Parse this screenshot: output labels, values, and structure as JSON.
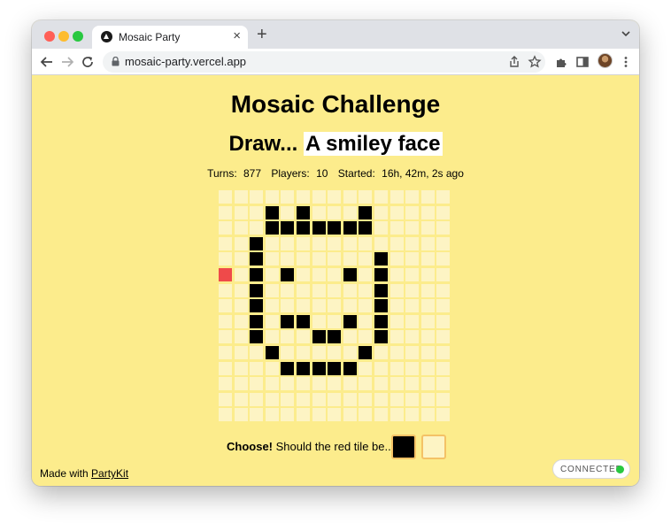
{
  "browser": {
    "tab_title": "Mosaic Party",
    "url": "mosaic-party.vercel.app",
    "icons": [
      "back-icon",
      "forward-icon",
      "reload-icon",
      "lock-icon",
      "share-icon",
      "bookmark-star-icon",
      "extensions-icon",
      "side-panel-icon",
      "menu-icon",
      "tab-close-icon",
      "new-tab-icon",
      "tab-search-icon"
    ],
    "traffic_light_colors": [
      "#ff5f57",
      "#febc2e",
      "#28c840"
    ]
  },
  "page": {
    "title": "Mosaic Challenge",
    "prompt_prefix": "Draw...",
    "prompt_subject": "A smiley face",
    "stats": {
      "turns_label": "Turns:",
      "turns": "877",
      "players_label": "Players:",
      "players": "10",
      "started_label": "Started:",
      "started": "16h, 42m, 2s ago"
    }
  },
  "mosaic": {
    "size": 15,
    "colors": {
      "empty": "#fdf4c4",
      "black": "#000000",
      "selected": "#ef4a4a"
    },
    "black_tiles": [
      [
        3,
        1
      ],
      [
        5,
        1
      ],
      [
        9,
        1
      ],
      [
        3,
        2
      ],
      [
        4,
        2
      ],
      [
        5,
        2
      ],
      [
        6,
        2
      ],
      [
        7,
        2
      ],
      [
        8,
        2
      ],
      [
        9,
        2
      ],
      [
        2,
        3
      ],
      [
        2,
        4
      ],
      [
        10,
        4
      ],
      [
        2,
        5
      ],
      [
        4,
        5
      ],
      [
        8,
        5
      ],
      [
        10,
        5
      ],
      [
        2,
        6
      ],
      [
        10,
        6
      ],
      [
        2,
        7
      ],
      [
        10,
        7
      ],
      [
        2,
        8
      ],
      [
        4,
        8
      ],
      [
        5,
        8
      ],
      [
        8,
        8
      ],
      [
        10,
        8
      ],
      [
        2,
        9
      ],
      [
        6,
        9
      ],
      [
        7,
        9
      ],
      [
        10,
        9
      ],
      [
        3,
        10
      ],
      [
        9,
        10
      ],
      [
        4,
        11
      ],
      [
        5,
        11
      ],
      [
        6,
        11
      ],
      [
        7,
        11
      ],
      [
        8,
        11
      ]
    ],
    "selected_tile": [
      0,
      5
    ]
  },
  "choose": {
    "label_bold": "Choose!",
    "label_rest": "Should the red tile be...",
    "options": [
      {
        "name": "black",
        "color": "#000000"
      },
      {
        "name": "blank",
        "color": "#fdf4c4"
      }
    ]
  },
  "footer": {
    "prefix": "Made with",
    "link": "PartyKit"
  },
  "status": {
    "text": "CONNECTED",
    "dot_color": "#28c840"
  }
}
